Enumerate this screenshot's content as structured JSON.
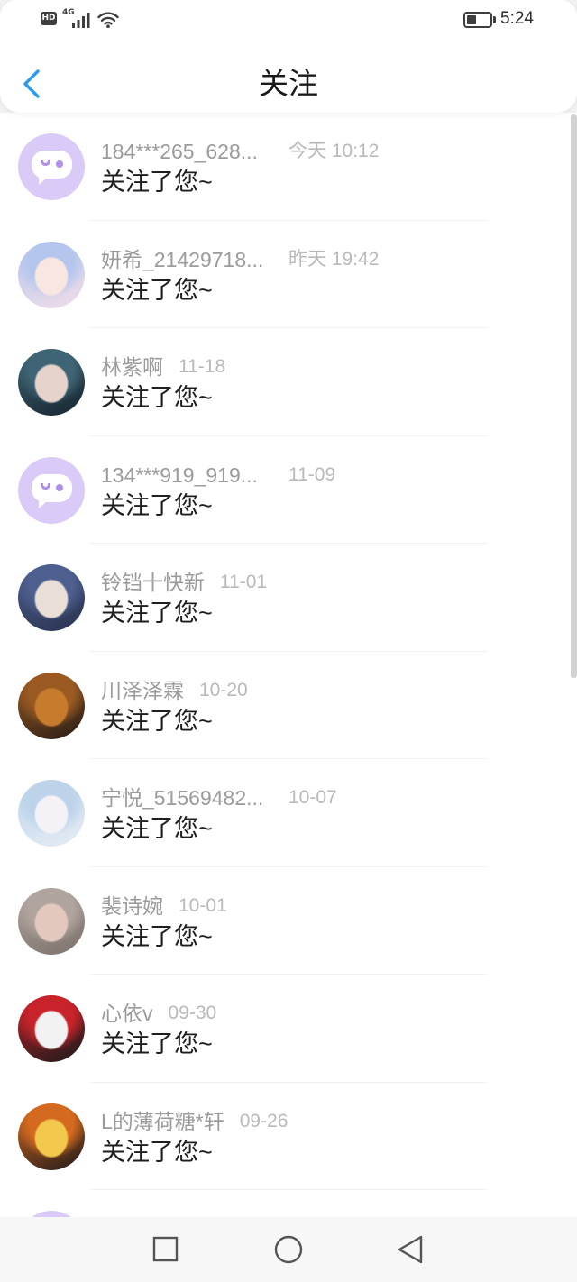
{
  "status_bar": {
    "network_badge": "HD",
    "network_type": "4G",
    "time": "5:24",
    "battery_level": 0.42,
    "icons": [
      "hd-badge-icon",
      "signal-icon",
      "wifi-icon",
      "battery-icon"
    ]
  },
  "header": {
    "back_icon": "chevron-left-icon",
    "title": "关注",
    "accent_color": "#2a9af0"
  },
  "notifications": [
    {
      "username": "184***265_628...",
      "time": "今天 10:12",
      "message": "关注了您~",
      "avatar": {
        "icon": "default-chat-avatar",
        "colors": [
          "#dacaf7",
          "#ffffff",
          "#b08ee9"
        ]
      }
    },
    {
      "username": "妍希_21429718...",
      "time": "昨天 19:42",
      "message": "关注了您~",
      "avatar": {
        "icon": "user-photo-avatar",
        "colors": [
          "#f8e6e0",
          "#b4c6ee",
          "#f1dde8"
        ]
      }
    },
    {
      "username": "林紫啊",
      "time": "11-18",
      "message": "关注了您~",
      "avatar": {
        "icon": "user-photo-avatar",
        "colors": [
          "#e6d3cc",
          "#3f6475",
          "#16252f"
        ]
      }
    },
    {
      "username": "134***919_919...",
      "time": "11-09",
      "message": "关注了您~",
      "avatar": {
        "icon": "default-chat-avatar",
        "colors": [
          "#dacaf7",
          "#ffffff",
          "#b08ee9"
        ]
      }
    },
    {
      "username": "铃铛十快新",
      "time": "11-01",
      "message": "关注了您~",
      "avatar": {
        "icon": "user-photo-avatar",
        "colors": [
          "#eadfd6",
          "#4d5f8f",
          "#2a3350"
        ]
      }
    },
    {
      "username": "川泽泽霖",
      "time": "10-20",
      "message": "关注了您~",
      "avatar": {
        "icon": "user-photo-avatar",
        "colors": [
          "#c77b2d",
          "#9a5a22",
          "#2a1e17"
        ]
      }
    },
    {
      "username": "宁悦_51569482...",
      "time": "10-07",
      "message": "关注了您~",
      "avatar": {
        "icon": "user-photo-avatar",
        "colors": [
          "#f4f2f7",
          "#bcd3ea",
          "#e6edf5"
        ]
      }
    },
    {
      "username": "裴诗婉",
      "time": "10-01",
      "message": "关注了您~",
      "avatar": {
        "icon": "user-photo-avatar",
        "colors": [
          "#e3c9bd",
          "#b0a49e",
          "#7d716c"
        ]
      }
    },
    {
      "username": "心依v",
      "time": "09-30",
      "message": "关注了您~",
      "avatar": {
        "icon": "user-photo-avatar",
        "colors": [
          "#f2f2f2",
          "#c8232a",
          "#1a1a1a"
        ]
      }
    },
    {
      "username": "L的薄荷糖*轩",
      "time": "09-26",
      "message": "关注了您~",
      "avatar": {
        "icon": "user-photo-avatar",
        "colors": [
          "#f2c94c",
          "#d46a1f",
          "#241c1a"
        ]
      }
    }
  ],
  "partial_item": {
    "avatar": {
      "icon": "default-chat-avatar",
      "colors": [
        "#dacaf7",
        "#ffffff",
        "#b08ee9"
      ]
    }
  },
  "nav_bar": {
    "icons": [
      "recent-apps-icon",
      "home-icon",
      "back-icon"
    ]
  }
}
